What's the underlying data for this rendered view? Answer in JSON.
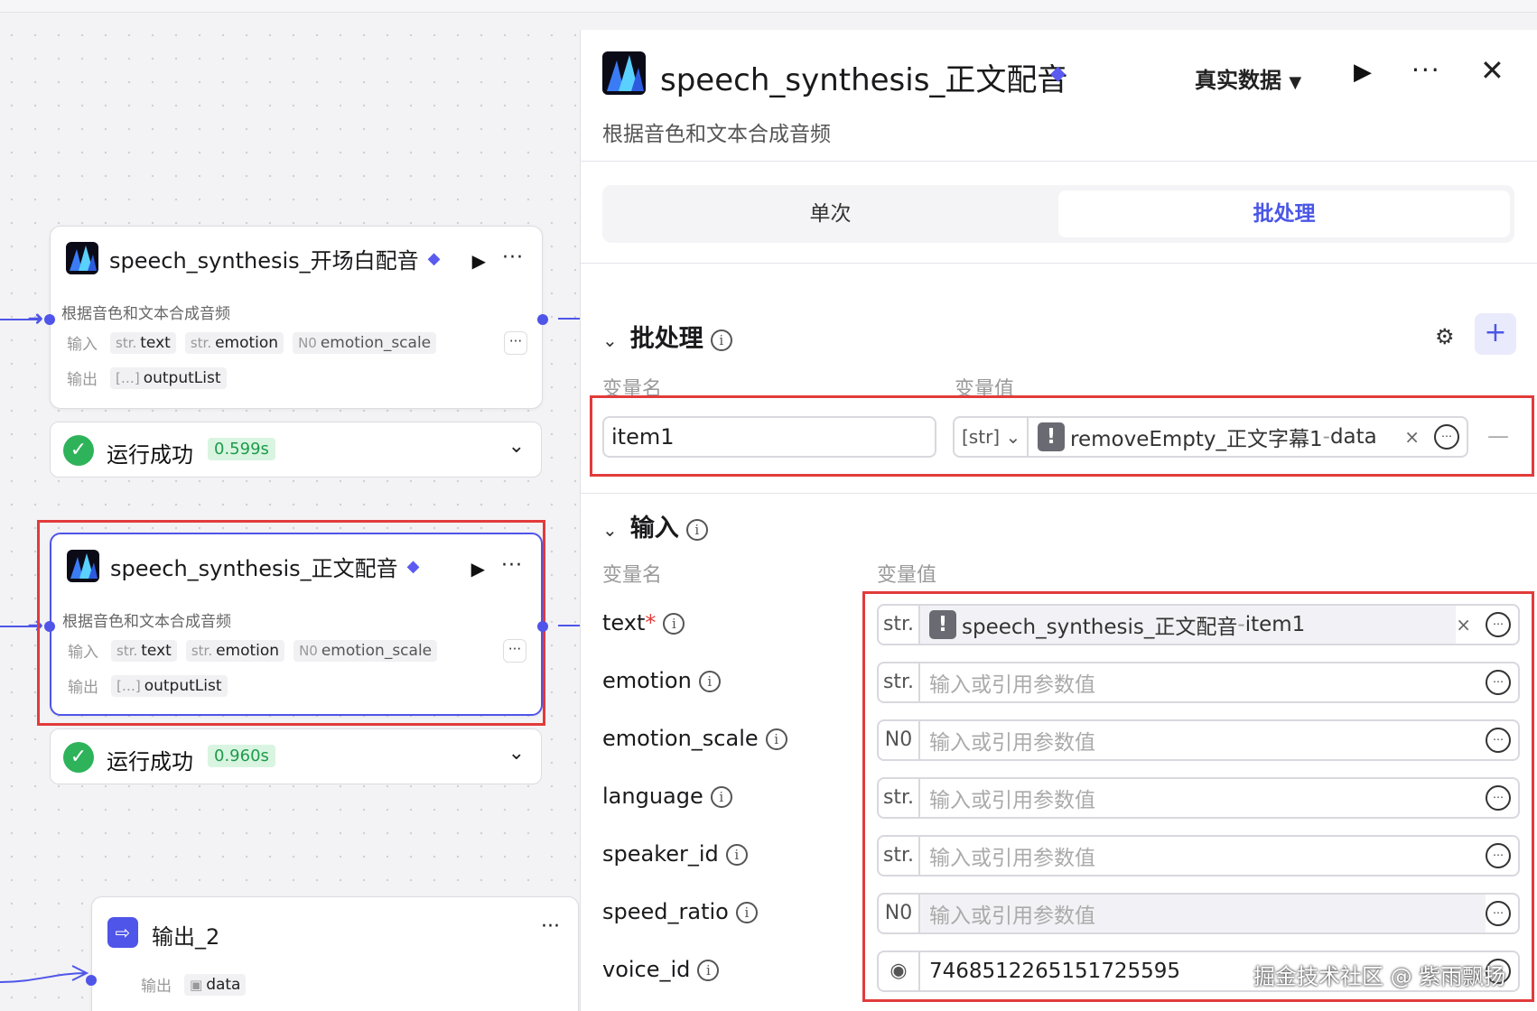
{
  "canvas": {
    "nodes": [
      {
        "title": "speech_synthesis_开场白配音",
        "description": "根据音色和文本合成音频",
        "input_label": "输入",
        "output_label": "输出",
        "inputs": [
          {
            "type": "str.",
            "name": "text"
          },
          {
            "type": "str.",
            "name": "emotion"
          },
          {
            "type": "N0",
            "name": "emotion_scale"
          }
        ],
        "outputs": [
          {
            "type": "[…]",
            "name": "outputList"
          }
        ],
        "more": "···",
        "status": {
          "text": "运行成功",
          "time": "0.599s"
        }
      },
      {
        "title": "speech_synthesis_正文配音",
        "description": "根据音色和文本合成音频",
        "input_label": "输入",
        "output_label": "输出",
        "inputs": [
          {
            "type": "str.",
            "name": "text"
          },
          {
            "type": "str.",
            "name": "emotion"
          },
          {
            "type": "N0",
            "name": "emotion_scale"
          }
        ],
        "outputs": [
          {
            "type": "[…]",
            "name": "outputList"
          }
        ],
        "more": "···",
        "status": {
          "text": "运行成功",
          "time": "0.960s"
        }
      }
    ],
    "output_node": {
      "title": "输出_2",
      "output_label": "输出",
      "outputs": [
        {
          "type": "img",
          "name": "data"
        }
      ]
    }
  },
  "panel": {
    "title": "speech_synthesis_正文配音",
    "description": "根据音色和文本合成音频",
    "data_mode": "真实数据",
    "tabs": {
      "single": "单次",
      "batch": "批处理",
      "active": "批处理"
    },
    "batch": {
      "title": "批处理",
      "col_name": "变量名",
      "col_value": "变量值",
      "item": {
        "name": "item1",
        "type": "[str]",
        "ref_source": "removeEmpty_正文字幕1",
        "ref_sep": " - ",
        "ref_field": "data"
      }
    },
    "inputs": {
      "title": "输入",
      "col_name": "变量名",
      "col_value": "变量值",
      "placeholder": "输入或引用参数值",
      "params": [
        {
          "name": "text",
          "required": true,
          "type": "str.",
          "ref_source": "speech_synthesis_正文配音",
          "ref_field": "item1"
        },
        {
          "name": "emotion",
          "type": "str."
        },
        {
          "name": "emotion_scale",
          "type": "N0"
        },
        {
          "name": "language",
          "type": "str."
        },
        {
          "name": "speaker_id",
          "type": "str."
        },
        {
          "name": "speed_ratio",
          "type": "N0"
        },
        {
          "name": "voice_id",
          "type": "audio",
          "value": "7468512265151725595"
        }
      ]
    }
  },
  "watermark": "掘金技术社区 @ 紫雨飘扬",
  "colors": {
    "accent": "#4a56e6",
    "highlight": "#e23b3b",
    "success": "#2eb35a"
  }
}
